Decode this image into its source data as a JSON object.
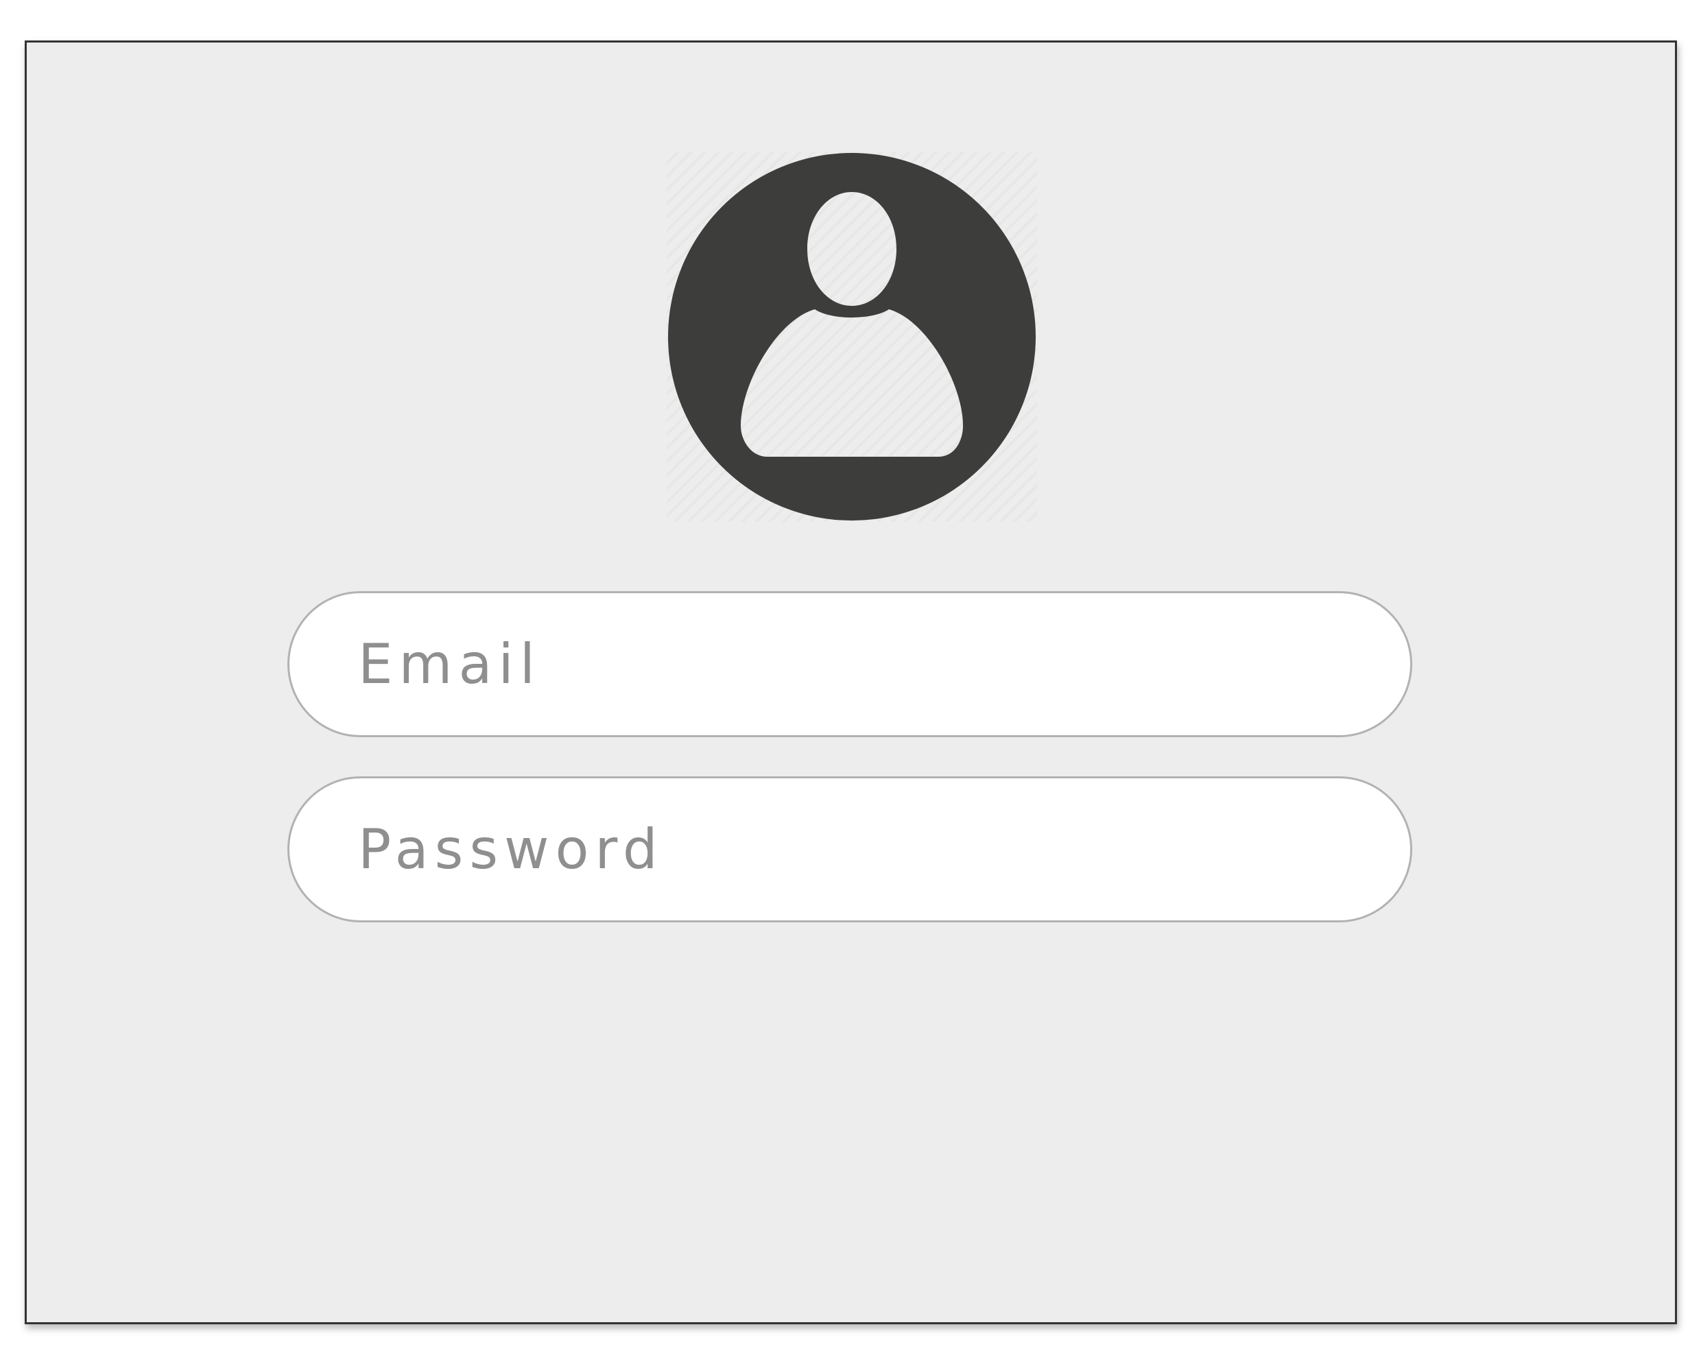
{
  "login_form": {
    "avatar_icon": "user-avatar-icon",
    "email": {
      "placeholder": "Email",
      "value": ""
    },
    "password": {
      "placeholder": "Password",
      "value": ""
    }
  },
  "colors": {
    "background": "#ededed",
    "frame_border": "#333333",
    "avatar": "#3d3d3b",
    "field_background": "#ffffff",
    "field_border": "#b2b2b2",
    "placeholder_text": "#8f8f8f"
  }
}
